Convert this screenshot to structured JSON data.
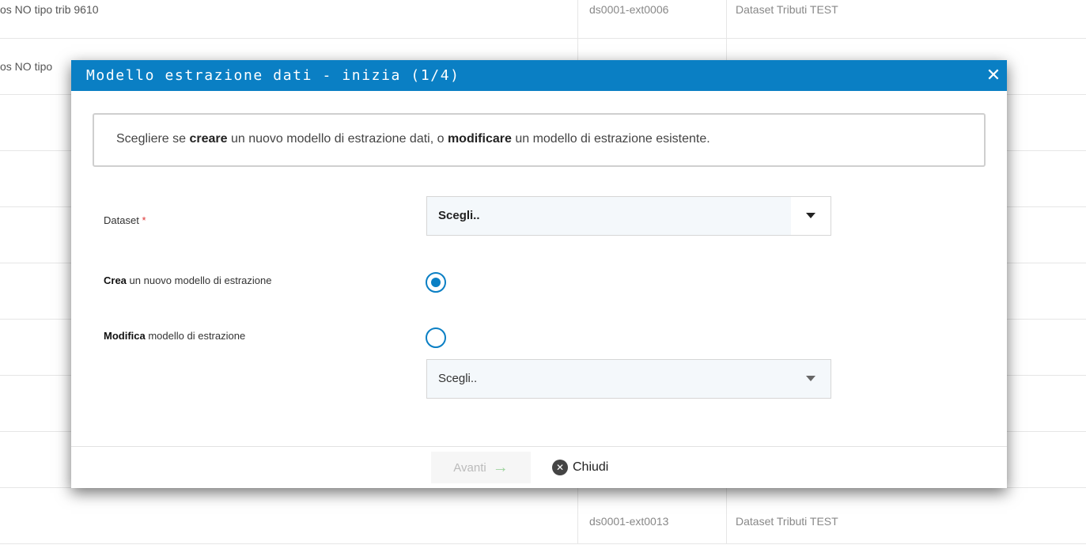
{
  "background": {
    "rows": [
      {
        "col1": "os NO tipo trib 9610",
        "col2": "ds0001-ext0006",
        "col3": "Dataset Tributi TEST"
      },
      {
        "col1": "os NO tipo",
        "col2": "",
        "col3": ""
      },
      {
        "col1": "",
        "col2": "",
        "col3": ""
      },
      {
        "col1": "",
        "col2": "",
        "col3": ""
      },
      {
        "col1": "",
        "col2": "",
        "col3": ""
      },
      {
        "col1": "",
        "col2": "",
        "col3": ""
      },
      {
        "col1": "",
        "col2": "",
        "col3": ""
      },
      {
        "col1": "",
        "col2": "",
        "col3": ""
      },
      {
        "col1": "",
        "col2": "ds0001-ext0013",
        "col3": "Dataset Tributi TEST"
      }
    ]
  },
  "modal": {
    "title": "Modello estrazione dati - inizia (1/4)",
    "close_symbol": "✕",
    "info": {
      "part1": "Scegliere se ",
      "bold1": "creare",
      "part2": " un nuovo modello di estrazione dati, o ",
      "bold2": "modificare",
      "part3": " un modello di estrazione esistente."
    },
    "dataset": {
      "label": "Dataset",
      "required_mark": "*",
      "select_value": "Scegli.."
    },
    "create_option": {
      "bold": "Crea",
      "rest": " un nuovo modello di estrazione",
      "checked": true
    },
    "modify_option": {
      "bold": "Modifica",
      "rest": " modello di estrazione",
      "checked": false,
      "select_value": "Scegli.."
    },
    "footer": {
      "next_label": "Avanti",
      "next_icon": "arrow-right-icon",
      "close_label": "Chiudi",
      "close_icon": "close-circle-icon"
    }
  },
  "colors": {
    "header": "#0a7fc4",
    "radio": "#0a7fc4",
    "next_arrow": "#9ed39e"
  }
}
